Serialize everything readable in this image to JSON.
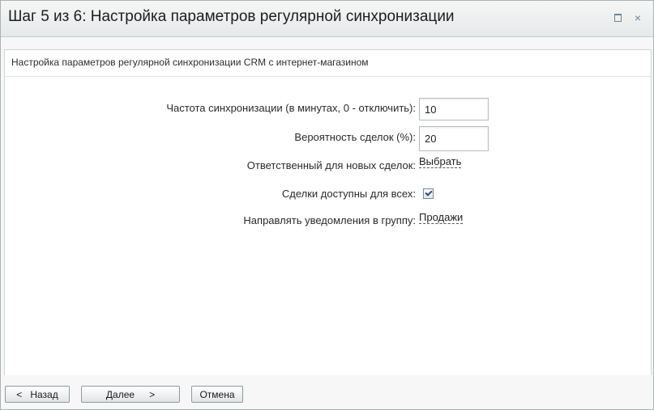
{
  "window": {
    "title": "Шаг 5 из 6: Настройка параметров регулярной синхронизации",
    "maximize_icon": "maximize-icon",
    "close_icon": "close-icon",
    "close_glyph": "×"
  },
  "section": {
    "header": "Настройка параметров регулярной синхронизации CRM с интернет-магазином"
  },
  "form": {
    "sync_frequency": {
      "label": "Частота синхронизации (в минутах, 0 - отключить):",
      "value": "10"
    },
    "deal_probability": {
      "label": "Вероятность сделок (%):",
      "value": "20"
    },
    "responsible": {
      "label": "Ответственный для новых сделок:",
      "link": "Выбрать"
    },
    "deals_public": {
      "label": "Сделки доступны для всех:",
      "checked": true
    },
    "notify_group": {
      "label": "Направлять уведомления в группу:",
      "link": "Продажи"
    }
  },
  "footer": {
    "back_arrow": "<",
    "back_label": "Назад",
    "next_label": "Далее",
    "next_arrow": ">",
    "cancel_label": "Отмена"
  }
}
